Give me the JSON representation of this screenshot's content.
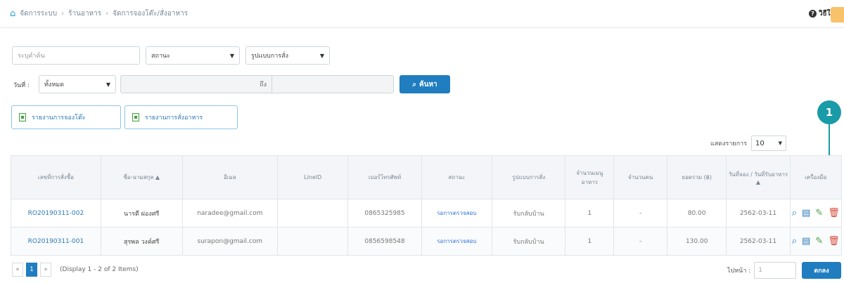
{
  "breadcrumb": [
    "จัดการระบบ",
    "ร้านอาหาร",
    "จัดการจองโต๊ะ/สั่งอาหาร"
  ],
  "help_label": "วิธีใช้",
  "filters": {
    "search_placeholder": "ระบุคำค้น",
    "status_value": "สถานะ",
    "order_type_value": "รูปแบบการสั่ง",
    "date_label": "วันที่ :",
    "date_value": "ทั้งหมด",
    "to_label": "ถึง",
    "search_button": "ค้นหา"
  },
  "reports": {
    "booking_report": "รายงานการจองโต๊ะ",
    "food_report": "รายงานการสั่งอาหาร"
  },
  "annotation_number": "1",
  "page_size": {
    "label": "แสดงรายการ",
    "value": "10"
  },
  "table": {
    "headers": [
      "เลขที่การสั่งซื้อ",
      "ชื่อ-นามสกุล ▲",
      "อีเมล",
      "LineID",
      "เบอร์โทรศัพท์",
      "สถานะ",
      "รูปแบบการสั่ง",
      "จำนวนเมนู อาหาร",
      "จำนวนคน",
      "ยอดรวม (฿)",
      "วันที่จอง / วันที่รับอาหาร ▲",
      "เครื่องมือ"
    ],
    "rows": [
      {
        "order": "RO20190311-002",
        "name": "นารดี ผ่องศรี",
        "email": "naradee@gmail.com",
        "line": "",
        "phone": "0865325985",
        "status": "รอการตรวจสอบ",
        "type": "รับกลับบ้าน",
        "menus": "1",
        "people": "-",
        "total": "80.00",
        "date": "2562-03-11"
      },
      {
        "order": "RO20190311-001",
        "name": "สุรพล วงค์ศรี",
        "email": "surapon@gmail.com",
        "line": "",
        "phone": "0856598548",
        "status": "รอการตรวจสอบ",
        "type": "รับกลับบ้าน",
        "menus": "1",
        "people": "-",
        "total": "130.00",
        "date": "2562-03-11"
      }
    ]
  },
  "pagination": {
    "prev": "«",
    "current": "1",
    "next": "»",
    "info": "(Display 1 - 2 of 2 Items)"
  },
  "goto": {
    "label": "ไปหน้า :",
    "value": "1",
    "button": "ตกลง"
  },
  "icons": {
    "home": "home-icon",
    "search": "search-icon",
    "report": "document-icon",
    "view": "magnifier-icon",
    "detail": "document-icon",
    "edit": "pencil-icon",
    "delete": "trash-icon"
  },
  "colors": {
    "primary": "#1f7dc0",
    "badge": "#1a9ba8",
    "edit": "#49a33f",
    "delete": "#d64a3a"
  }
}
